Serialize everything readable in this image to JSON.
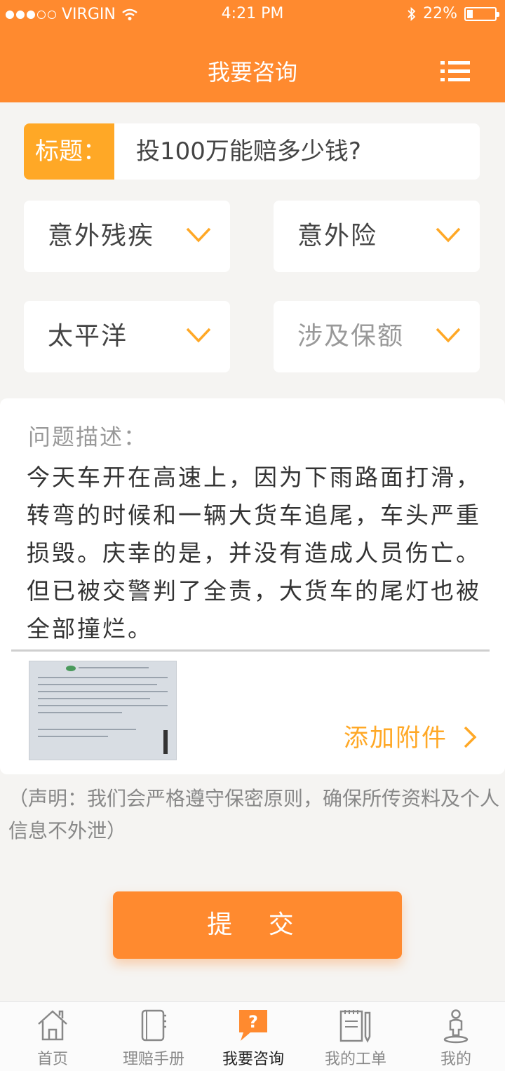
{
  "status_bar": {
    "carrier": "VIRGIN",
    "time": "4:21 PM",
    "battery": "22%",
    "battery_level": 0.22
  },
  "header": {
    "title": "我要咨询",
    "menu_icon": "list-menu-icon"
  },
  "form": {
    "title_label": "标题：",
    "title_value": "投100万能赔多少钱?",
    "selects": [
      {
        "value": "意外残疾",
        "placeholder": false
      },
      {
        "value": "意外险",
        "placeholder": false
      },
      {
        "value": "太平洋",
        "placeholder": false
      },
      {
        "value": "涉及保额",
        "placeholder": true
      }
    ],
    "description_label": "问题描述：",
    "description_text": "今天车开在高速上，因为下雨路面打滑，转弯的时候和一辆大货车追尾，车头严重损毁。庆幸的是，并没有造成人员伤亡。但已被交警判了全责，大货车的尾灯也被全部撞烂。",
    "attach_label": "添加附件"
  },
  "notice": "（声明：我们会严格遵守保密原则，确保所传资料及个人信息不外泄）",
  "submit_label": "提 交",
  "tabs": [
    {
      "label": "首页",
      "icon": "home-icon",
      "active": false
    },
    {
      "label": "理赔手册",
      "icon": "book-icon",
      "active": false
    },
    {
      "label": "我要咨询",
      "icon": "question-bubble-icon",
      "active": true
    },
    {
      "label": "我的工单",
      "icon": "notebook-pen-icon",
      "active": false
    },
    {
      "label": "我的",
      "icon": "person-pin-icon",
      "active": false
    }
  ],
  "colors": {
    "brand": "#ff8a2f",
    "accent": "#ffa826"
  }
}
